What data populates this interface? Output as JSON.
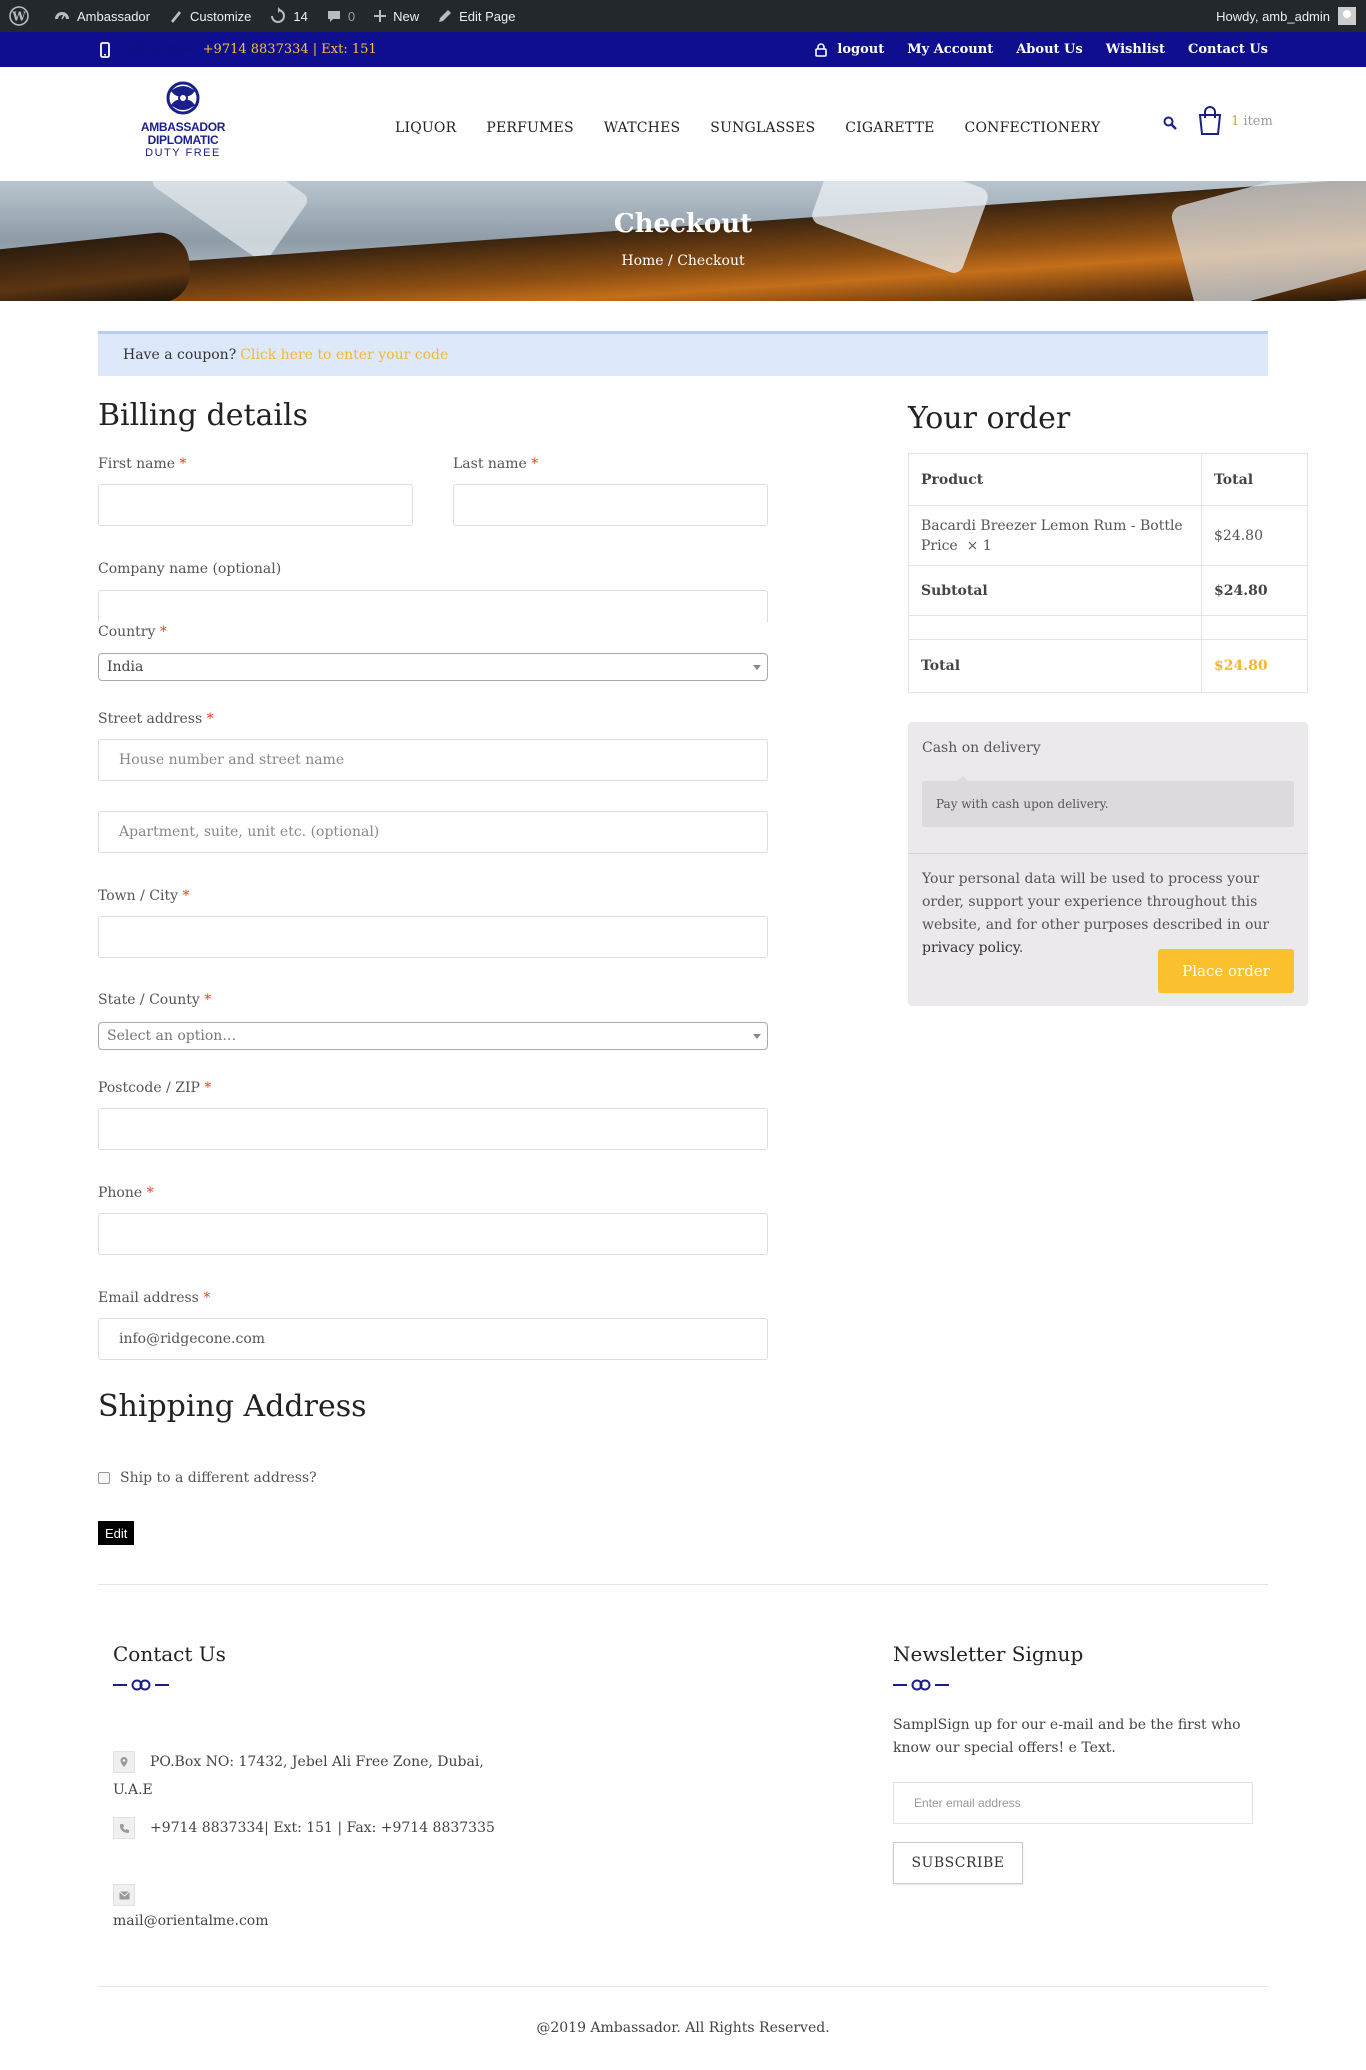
{
  "adminbar": {
    "site": "Ambassador",
    "customize": "Customize",
    "updates": "14",
    "comments": "0",
    "new": "New",
    "edit_page": "Edit Page",
    "howdy": "Howdy, amb_admin"
  },
  "topbar": {
    "call_label": "Call us now",
    "phone": "+9714 8837334 | Ext: 151",
    "links": [
      "logout",
      "My Account",
      "About Us",
      "Wishlist",
      "Contact Us"
    ]
  },
  "header": {
    "logo_line1": "AMBASSADOR",
    "logo_line2": "DIPLOMATIC",
    "logo_line3": "DUTY FREE",
    "nav": [
      "LIQUOR",
      "PERFUMES",
      "WATCHES",
      "SUNGLASSES",
      "CIGARETTE",
      "CONFECTIONERY"
    ],
    "cart_count": "1",
    "cart_label": " item"
  },
  "hero": {
    "title": "Checkout",
    "breadcrumb": "Home / Checkout"
  },
  "coupon": {
    "text": "Have a coupon?",
    "link": "Click here to enter your code"
  },
  "billing": {
    "title": "Billing details",
    "first_name_label": "First name",
    "last_name_label": "Last name",
    "company_label": "Company name (optional)",
    "country_label": "Country",
    "country_value": "India",
    "street_label": "Street address",
    "street_placeholder": "House number and street name",
    "apartment_placeholder": "Apartment, suite, unit etc. (optional)",
    "city_label": "Town / City",
    "state_label": "State / County",
    "state_placeholder": "Select an option…",
    "postcode_label": "Postcode / ZIP",
    "phone_label": "Phone",
    "email_label": "Email address",
    "email_value": "info@ridgecone.com",
    "required_mark": "*"
  },
  "shipping": {
    "title": "Shipping Address",
    "checkbox_label": "Ship to a different address?",
    "edit_label": "Edit"
  },
  "order": {
    "title": "Your order",
    "col_product": "Product",
    "col_total": "Total",
    "item_name": "Bacardi Breezer Lemon Rum - Bottle Price",
    "item_qty": "× 1",
    "item_total": "$24.80",
    "subtotal_label": "Subtotal",
    "subtotal_value": "$24.80",
    "total_label": "Total",
    "total_value": "$24.80",
    "payment_method": "Cash on delivery",
    "payment_desc": "Pay with cash upon delivery.",
    "privacy_text": "Your personal data will be used to process your order, support your experience throughout this website, and for other purposes described in our",
    "privacy_link": "privacy policy",
    "place_order": "Place order"
  },
  "footer": {
    "contact_title": "Contact Us",
    "address": "PO.Box NO: 17432, Jebel Ali Free Zone, Dubai,",
    "address2": "U.A.E",
    "phone": "+9714 8837334| Ext: 151  | Fax: +9714 8837335",
    "email": "mail@orientalme.com",
    "newsletter_title": "Newsletter Signup",
    "newsletter_text": "SamplSign up for our e-mail and be the first who know our special offers! e Text.",
    "email_placeholder": "Enter email address",
    "subscribe": "SUBSCRIBE",
    "copyright": "@2019 Ambassador. All Rights Reserved."
  },
  "colors": {
    "topbar": "#0e0e8f",
    "accent": "#fbc02d",
    "link": "#f5b731",
    "coupon_bg": "#dde9fb"
  }
}
